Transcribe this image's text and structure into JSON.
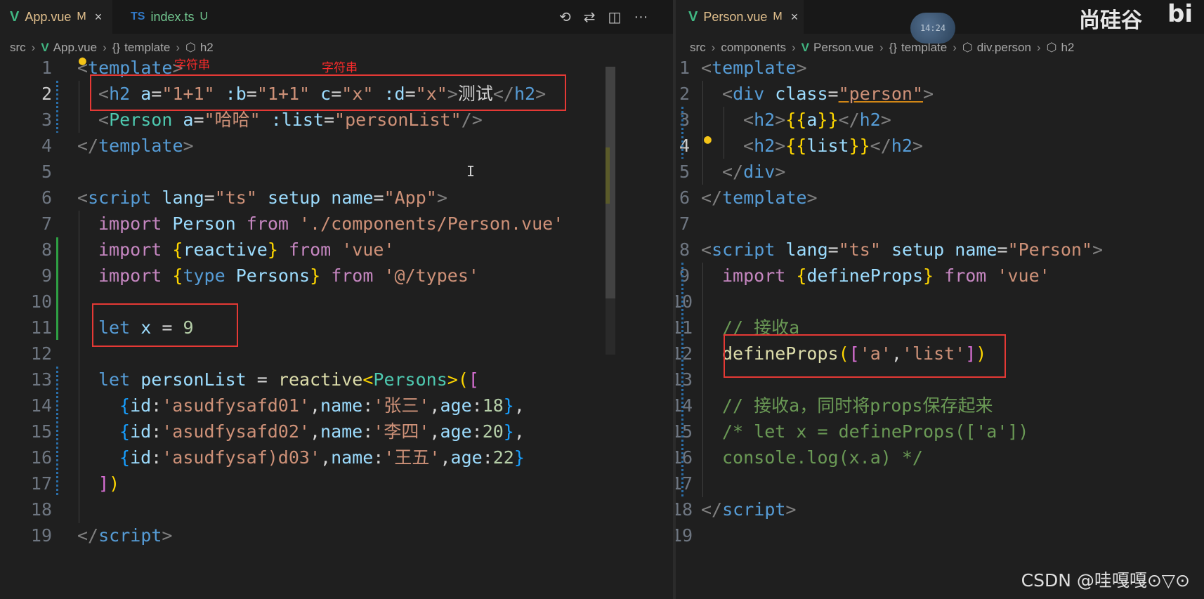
{
  "left": {
    "tabs": [
      {
        "name": "App.vue",
        "status": "M",
        "active": true,
        "close": "×"
      },
      {
        "name": "index.ts",
        "status": "U",
        "active": false,
        "lang": "TS"
      }
    ],
    "breadcrumb": {
      "root": "src",
      "file": "App.vue",
      "section": "template",
      "section_icon": "{}",
      "node": "h2"
    },
    "annotations": [
      "字符串",
      "字符串"
    ],
    "lines": [
      {
        "n": "1"
      },
      {
        "n": "2"
      },
      {
        "n": "3"
      },
      {
        "n": "4"
      },
      {
        "n": "5"
      },
      {
        "n": "6"
      },
      {
        "n": "7"
      },
      {
        "n": "8"
      },
      {
        "n": "9"
      },
      {
        "n": "10"
      },
      {
        "n": "11"
      },
      {
        "n": "12"
      },
      {
        "n": "13"
      },
      {
        "n": "14"
      },
      {
        "n": "15"
      },
      {
        "n": "16"
      },
      {
        "n": "17"
      },
      {
        "n": "18"
      },
      {
        "n": "19"
      }
    ],
    "code": {
      "l1": [
        "<",
        "template",
        ">"
      ],
      "l2": [
        "<",
        "h2",
        " a",
        "=",
        "\"1+1\"",
        " :b",
        "=",
        "\"1+1\"",
        " c",
        "=",
        "\"x\"",
        " :d",
        "=",
        "\"x\"",
        ">",
        "测试",
        "</",
        "h2",
        ">"
      ],
      "l3": [
        "<",
        "Person",
        " a",
        "=",
        "\"哈哈\"",
        " :list",
        "=",
        "\"personList\"",
        "/>"
      ],
      "l4": [
        "</",
        "template",
        ">"
      ],
      "l6": [
        "<",
        "script",
        " lang",
        "=",
        "\"ts\"",
        " setup",
        " name",
        "=",
        "\"App\"",
        ">"
      ],
      "l7": [
        "import",
        " Person ",
        "from",
        " './components/Person.vue'"
      ],
      "l8": [
        "import",
        " ",
        "{",
        "reactive",
        "}",
        " ",
        "from",
        " 'vue'"
      ],
      "l9": [
        "import",
        " ",
        "{",
        "type",
        " Persons",
        "}",
        " ",
        "from",
        " '@/types'"
      ],
      "l11": [
        "let",
        " x ",
        "=",
        " ",
        "9"
      ],
      "l13": [
        "let",
        " personList ",
        "=",
        " ",
        "reactive",
        "<",
        "Persons",
        ">",
        "(",
        "["
      ],
      "l14": [
        "{",
        "id",
        ":",
        "'asudfysafd01'",
        ",",
        "name",
        ":",
        "'张三'",
        ",",
        "age",
        ":",
        "18",
        "}",
        ","
      ],
      "l15": [
        "{",
        "id",
        ":",
        "'asudfysafd02'",
        ",",
        "name",
        ":",
        "'李四'",
        ",",
        "age",
        ":",
        "20",
        "}",
        ","
      ],
      "l16": [
        "{",
        "id",
        ":",
        "'asudfysaf)d03'",
        ",",
        "name",
        ":",
        "'王五'",
        ",",
        "age",
        ":",
        "22",
        "}"
      ],
      "l17": [
        "]",
        ")"
      ],
      "l19": [
        "</",
        "script",
        ">"
      ]
    }
  },
  "right": {
    "tabs": [
      {
        "name": "Person.vue",
        "status": "M",
        "active": true,
        "close": "×"
      }
    ],
    "breadcrumb": {
      "root": "src",
      "folder": "components",
      "file": "Person.vue",
      "section": "template",
      "section_icon": "{}",
      "node1": "div.person",
      "node2": "h2"
    },
    "lines": [
      {
        "n": "1"
      },
      {
        "n": "2"
      },
      {
        "n": "3"
      },
      {
        "n": "4"
      },
      {
        "n": "5"
      },
      {
        "n": "6"
      },
      {
        "n": "7"
      },
      {
        "n": "8"
      },
      {
        "n": "9"
      },
      {
        "n": "10"
      },
      {
        "n": "11"
      },
      {
        "n": "12"
      },
      {
        "n": "13"
      },
      {
        "n": "14"
      },
      {
        "n": "15"
      },
      {
        "n": "16"
      },
      {
        "n": "17"
      },
      {
        "n": "18"
      },
      {
        "n": "19"
      }
    ],
    "code": {
      "l1": [
        "<",
        "template",
        ">"
      ],
      "l2": [
        "<",
        "div",
        " class",
        "=",
        "\"person\"",
        ">"
      ],
      "l3": [
        "<",
        "h2",
        ">",
        "{{",
        "a",
        "}}",
        "</",
        "h2",
        ">"
      ],
      "l4": [
        "<",
        "h2",
        ">",
        "{{",
        "list",
        "}}",
        "</",
        "h2",
        ">"
      ],
      "l5": [
        "</",
        "div",
        ">"
      ],
      "l6": [
        "</",
        "template",
        ">"
      ],
      "l8": [
        "<",
        "script",
        " lang",
        "=",
        "\"ts\"",
        " setup",
        " name",
        "=",
        "\"Person\"",
        ">"
      ],
      "l9": [
        "import",
        " ",
        "{",
        "defineProps",
        "}",
        " ",
        "from",
        " 'vue'"
      ],
      "l11": [
        "// 接收a"
      ],
      "l12": [
        "defineProps",
        "(",
        "[",
        "'a'",
        ",",
        "'list'",
        "]",
        ")"
      ],
      "l14": [
        "// 接收a，同时将props保存起来"
      ],
      "l15": [
        "/* let x = defineProps(['a'])"
      ],
      "l16": [
        "console.log(x.a) */"
      ],
      "l18": [
        "</",
        "script",
        ">"
      ]
    }
  },
  "overlay": {
    "brand": "尚硅谷",
    "brand_logo": "bi",
    "clock_text": "14:24",
    "watermark": "CSDN @哇嘎嘎⊙▽⊙"
  },
  "icons": [
    "history-icon",
    "compare-changes-icon",
    "split-editor-icon",
    "more-actions-icon",
    "lightbulb-icon"
  ]
}
